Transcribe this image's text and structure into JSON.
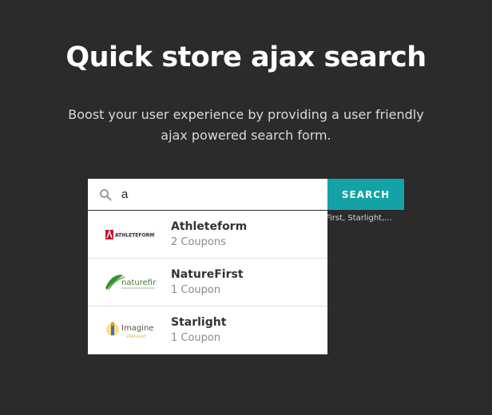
{
  "hero": {
    "title": "Quick store ajax search",
    "subtitle": "Boost your user experience by providing a user friendly ajax powered search form."
  },
  "search": {
    "value": "a",
    "button_label": "SEARCH",
    "hint_text": "First, Starlight,..."
  },
  "results": [
    {
      "name": "Athleteform",
      "coupons": "2 Coupons",
      "logo_text": "ATHLETEFORM",
      "logo_icon": "athleteform-logo"
    },
    {
      "name": "NatureFirst",
      "coupons": "1 Coupon",
      "logo_text": "naturefirst",
      "logo_icon": "naturefirst-logo"
    },
    {
      "name": "Starlight",
      "coupons": "1 Coupon",
      "logo_text": "Imagine",
      "logo_sub": "STARLIGHT",
      "logo_icon": "starlight-logo"
    }
  ],
  "colors": {
    "background": "#2b2b2b",
    "accent": "#13a2a6"
  }
}
